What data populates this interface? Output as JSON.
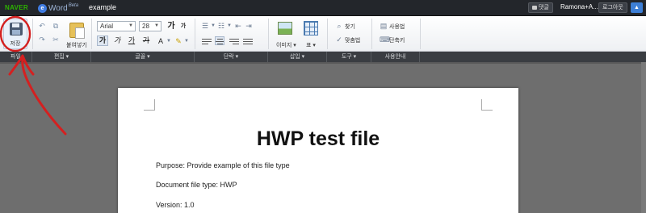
{
  "titlebar": {
    "brand": "NAVER",
    "app_icon": "e",
    "app_name": "Word",
    "app_badge": "Beta",
    "document_name": "example",
    "comment_label": "댓글",
    "user_name": "Ramona+A...",
    "logout_label": "로그아웃",
    "collapse_icon": "chevron-up-icon"
  },
  "ribbon": {
    "save_label": "저장",
    "paste_label": "붙여넣기",
    "font_name": "Arial",
    "font_size": "28",
    "grow_font": "가",
    "shrink_font": "가",
    "bold": "가",
    "italic": "가",
    "underline": "가",
    "strike": "가",
    "insert_image_label": "이미지 ▾",
    "insert_table_label": "표 ▾",
    "find_label": "찾기",
    "spellcheck_label": "맞춤법",
    "usage_label": "사용법",
    "shortcut_label": "단축키"
  },
  "sections": [
    "파일",
    "편집 ▾",
    "글꼴 ▾",
    "단락 ▾",
    "삽입 ▾",
    "도구 ▾",
    "사용안내"
  ],
  "document": {
    "title": "HWP test file",
    "lines": [
      "Purpose: Provide example of this file type",
      "Document file type: HWP",
      "Version: 1.0"
    ]
  },
  "colors": {
    "annotation": "#d42020",
    "titlebar_bg": "#23262b",
    "brand_green": "#2db400",
    "accent_blue": "#3d7fd6"
  }
}
